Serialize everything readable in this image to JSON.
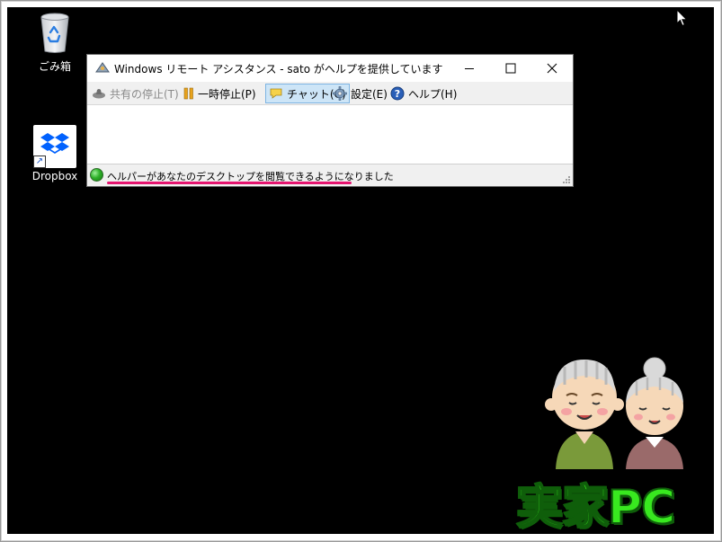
{
  "desktop": {
    "background": "#000000",
    "icons": [
      {
        "label": "ごみ箱",
        "icon": "recycle-bin-icon"
      },
      {
        "label": "Dropbox",
        "icon": "dropbox-icon"
      }
    ]
  },
  "window": {
    "title": "Windows リモート アシスタンス - sato がヘルプを提供しています",
    "controls": {
      "minimize": "minimize-icon",
      "maximize": "maximize-icon",
      "close": "close-icon"
    },
    "toolbar": {
      "stop_sharing": "共有の停止(T)",
      "pause": "一時停止(P)",
      "chat": "チャット(C)",
      "settings": "設定(E)",
      "help": "ヘルプ(H)"
    },
    "status": {
      "text": "ヘルパーがあなたのデスクトップを閲覧できるようになりました",
      "indicator_color": "#2fb12a",
      "underline_color": "#e5146f"
    }
  },
  "overlay": {
    "label": "実家PC",
    "label_color": "#38e81f"
  }
}
